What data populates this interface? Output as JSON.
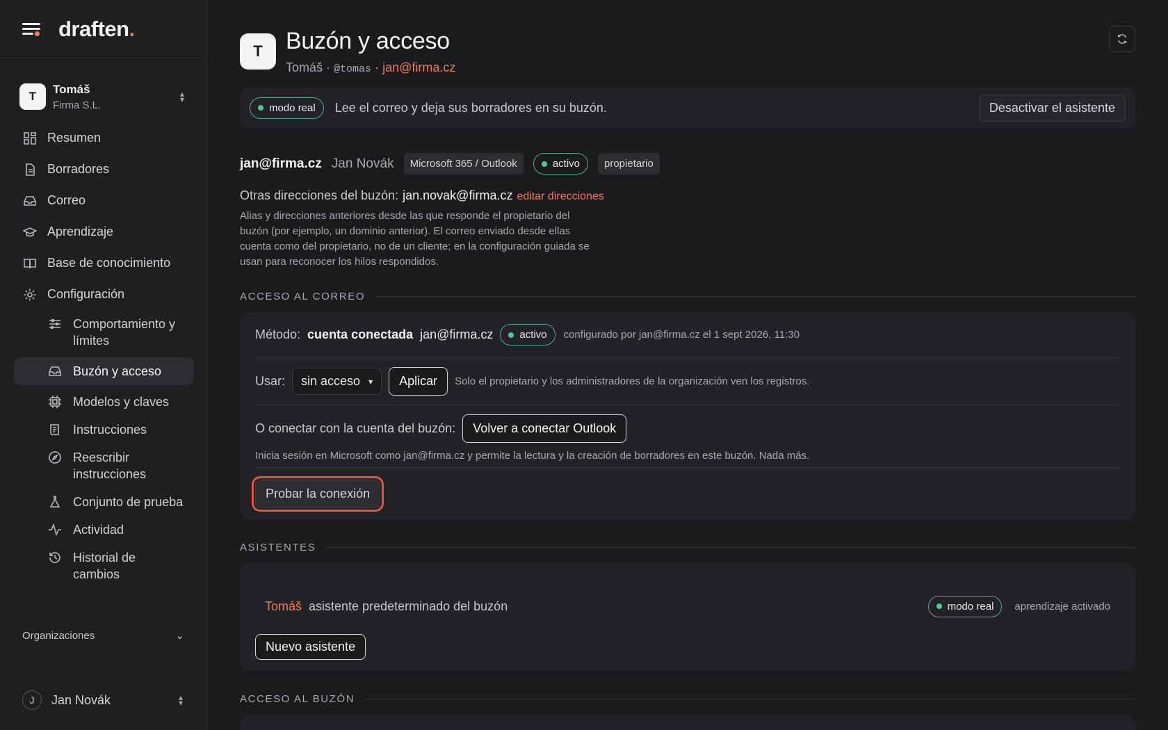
{
  "brand": {
    "logo": "draften",
    "logo_dot": "."
  },
  "account": {
    "initial": "T",
    "name": "Tomáš",
    "org": "Firma S.L."
  },
  "nav": {
    "items": [
      {
        "label": "Resumen"
      },
      {
        "label": "Borradores"
      },
      {
        "label": "Correo"
      },
      {
        "label": "Aprendizaje"
      },
      {
        "label": "Base de conocimiento"
      },
      {
        "label": "Configuración"
      }
    ],
    "sub": [
      {
        "label": "Comportamiento y límites"
      },
      {
        "label": "Buzón y acceso"
      },
      {
        "label": "Modelos y claves"
      },
      {
        "label": "Instrucciones"
      },
      {
        "label": "Reescribir instrucciones"
      },
      {
        "label": "Conjunto de prueba"
      },
      {
        "label": "Actividad"
      },
      {
        "label": "Historial de cambios"
      }
    ],
    "orgs_label": "Organizaciones"
  },
  "user": {
    "initial": "J",
    "name": "Jan Novák"
  },
  "header": {
    "initial": "T",
    "title": "Buzón y acceso",
    "name": "Tomáš",
    "sep": "·",
    "handle": "@tomas",
    "email": "jan@firma.cz"
  },
  "banner": {
    "mode": "modo real",
    "text": "Lee el correo y deja sus borradores en su buzón.",
    "deactivate": "Desactivar el asistente"
  },
  "mailbox": {
    "email": "jan@firma.cz",
    "name": "Jan Novák",
    "provider": "Microsoft 365 / Outlook",
    "status": "activo",
    "role": "propietario",
    "other_label": "Otras direcciones del buzón:",
    "other_value": "jan.novak@firma.cz",
    "edit_link": "editar direcciones",
    "desc": "Alias y direcciones anteriores desde las que responde el propietario del buzón (por ejemplo, un dominio anterior). El correo enviado desde ellas cuenta como del propietario, no de un cliente; en la configuración guiada se usan para reconocer los hilos respondidos."
  },
  "mail_access": {
    "heading": "ACCESO AL CORREO",
    "method_label": "Método:",
    "method_value": "cuenta conectada",
    "method_email": "jan@firma.cz",
    "status": "activo",
    "configured": "configurado por jan@firma.cz el 1 sept 2026, 11:30",
    "use_label": "Usar:",
    "use_value": "sin acceso",
    "apply": "Aplicar",
    "use_note": "Solo el propietario y los administradores de la organización ven los registros.",
    "connect_label": "O conectar con la cuenta del buzón:",
    "reconnect": "Volver a conectar Outlook",
    "connect_note": "Inicia sesión en Microsoft como jan@firma.cz y permite la lectura y la creación de borradores en este buzón. Nada más.",
    "test": "Probar la conexión"
  },
  "assistants": {
    "heading": "ASISTENTES",
    "name": "Tomáš",
    "desc": "asistente predeterminado del buzón",
    "mode": "modo real",
    "learning": "aprendizaje activado",
    "new": "Nuevo asistente"
  },
  "mailbox_access": {
    "heading": "ACCESO AL BUZÓN"
  },
  "colors": {
    "accent": "#f07a5f",
    "success": "#4ec79a",
    "focus": "#e2553e"
  }
}
